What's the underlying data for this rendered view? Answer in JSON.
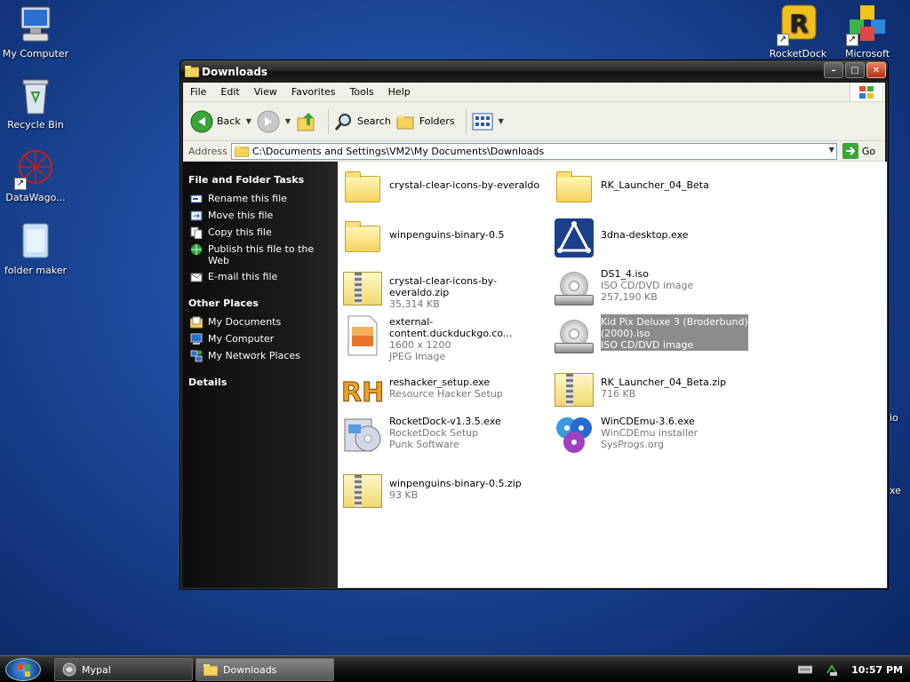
{
  "desktop": {
    "icons": [
      {
        "label": "My Computer"
      },
      {
        "label": "Recycle Bin"
      },
      {
        "label": "DataWago..."
      },
      {
        "label": "folder maker"
      },
      {
        "label": "RocketDock"
      },
      {
        "label": "Microsoft"
      }
    ],
    "edge_text_1": "io",
    "edge_text_2": "xe"
  },
  "window": {
    "title": "Downloads",
    "controls": {
      "minimize": "–",
      "maximize": "□",
      "close": "✕"
    }
  },
  "menubar": {
    "items": [
      "File",
      "Edit",
      "View",
      "Favorites",
      "Tools",
      "Help"
    ]
  },
  "toolbar": {
    "back_label": "Back",
    "search_label": "Search",
    "folders_label": "Folders"
  },
  "addressbar": {
    "label": "Address",
    "path": "C:\\Documents and Settings\\VM2\\My Documents\\Downloads",
    "go_label": "Go"
  },
  "leftpane": {
    "file_tasks": {
      "title": "File and Folder Tasks",
      "items": [
        "Rename this file",
        "Move this file",
        "Copy this file",
        "Publish this file to the Web",
        "E-mail this file"
      ]
    },
    "other_places": {
      "title": "Other Places",
      "items": [
        "My Documents",
        "My Computer",
        "My Network Places"
      ]
    },
    "details": {
      "title": "Details"
    }
  },
  "files": [
    {
      "name": "crystal-clear-icons-by-everaldo",
      "line2": "",
      "line3": "",
      "icon": "folder-icon"
    },
    {
      "name": "RK_Launcher_04_Beta",
      "line2": "",
      "line3": "",
      "icon": "folder-icon"
    },
    {
      "name": "winpenguins-binary-0.5",
      "line2": "",
      "line3": "",
      "icon": "folder-icon"
    },
    {
      "name": "3dna-desktop.exe",
      "line2": "",
      "line3": "",
      "icon": "3dna-icon"
    },
    {
      "name": "crystal-clear-icons-by-everaldo.zip",
      "line2": "35,314 KB",
      "line3": "",
      "icon": "zip-icon"
    },
    {
      "name": "DS1_4.iso",
      "line2": "ISO CD/DVD image",
      "line3": "257,190 KB",
      "icon": "disc-image-icon"
    },
    {
      "name": "external-content.duckduckgo.co...",
      "line2": "1600 x 1200",
      "line3": "JPEG Image",
      "icon": "jpeg-image-icon"
    },
    {
      "name": "Kid Pix Deluxe 3 (Broderbund)",
      "line2": "(2000).iso",
      "line3": "ISO CD/DVD image",
      "icon": "disc-image-icon"
    },
    {
      "name": "reshacker_setup.exe",
      "line2": "Resource Hacker Setup",
      "line3": "",
      "icon": "reshacker-icon"
    },
    {
      "name": "RK_Launcher_04_Beta.zip",
      "line2": "716 KB",
      "line3": "",
      "icon": "zip-icon"
    },
    {
      "name": "RocketDock-v1.3.5.exe",
      "line2": "RocketDock Setup",
      "line3": "Punk Software",
      "icon": "installer-icon"
    },
    {
      "name": "WinCDEmu-3.6.exe",
      "line2": "WinCDEmu installer",
      "line3": "SysProgs.org",
      "icon": "wincdemu-icon"
    },
    {
      "name": "winpenguins-binary-0.5.zip",
      "line2": "93 KB",
      "line3": "",
      "icon": "zip-icon"
    }
  ],
  "taskbar": {
    "tasks": [
      {
        "label": "Mypal"
      },
      {
        "label": "Downloads"
      }
    ],
    "clock": "10:57 PM"
  },
  "colors": {
    "selection": "#8c8c8c",
    "task_pane": "#1b1b1b",
    "desktop": "#1d4a9c"
  }
}
